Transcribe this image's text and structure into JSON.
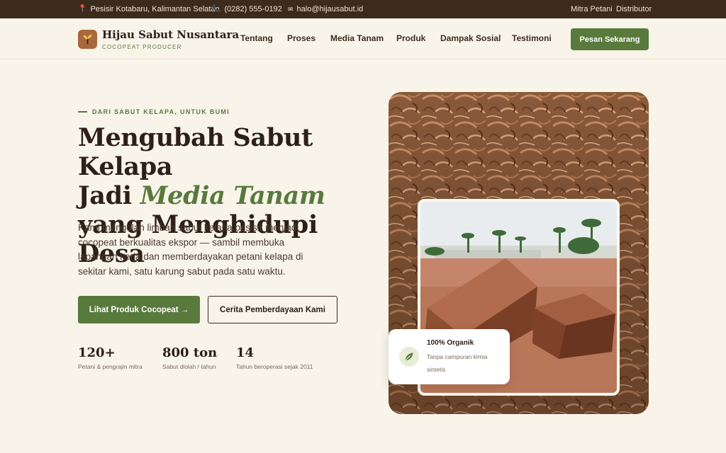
{
  "topbar": {
    "location": "Pesisir Kotabaru, Kalimantan Selatan",
    "phone": "(0282) 555-0192",
    "email": "halo@hijausabut.id",
    "links": [
      "Mitra Petani",
      "Distributor"
    ]
  },
  "header": {
    "brand_name": "Hijau Sabut Nusantara",
    "brand_tagline": "COCOPEAT PRODUCER",
    "nav": [
      "Tentang",
      "Proses",
      "Media Tanam",
      "Produk",
      "Dampak Sosial",
      "Testimoni"
    ],
    "cta_label": "Pesan Sekarang"
  },
  "hero": {
    "eyebrow": "DARI SABUT KELAPA, UNTUK BUMI",
    "headline_line1": "Mengubah Sabut Kelapa",
    "headline_line2_prefix": "Jadi ",
    "headline_accent": "Media Tanam",
    "headline_line3": "yang Menghidupi Desa",
    "lead": "Kami mengolah limbah sabut kelapa pesisir menjadi cocopeat berkualitas ekspor — sambil membuka lapangan kerja dan memberdayakan petani kelapa di sekitar kami, satu karung sabut pada satu waktu.",
    "primary_button": "Lihat Produk Cocopeat →",
    "secondary_button": "Cerita Pemberdayaan Kami",
    "stats": [
      {
        "value": "120+",
        "label": "Petani & pengrajin mitra"
      },
      {
        "value": "800 ton",
        "label": "Sabut diolah / tahun"
      },
      {
        "value": "14",
        "label": "Tahun beroperasi sejak 2011"
      }
    ],
    "badge": {
      "title": "100% Organik",
      "description": "Tanpa campuran kimia sintetis"
    }
  },
  "colors": {
    "brand_green": "#587a3c",
    "topbar_brown": "#3c2a1d",
    "background_cream": "#f8f4ea",
    "logo_brown": "#a8683b"
  },
  "icons": [
    "location-pin-icon",
    "phone-icon",
    "mail-icon",
    "sprout-logo-icon",
    "leaf-icon"
  ]
}
